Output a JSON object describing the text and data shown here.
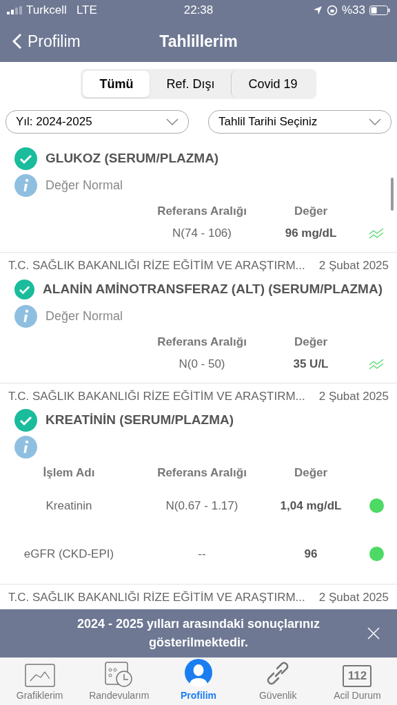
{
  "status_bar": {
    "carrier": "Turkcell",
    "network": "LTE",
    "time": "22:38",
    "battery": "%33"
  },
  "nav": {
    "back": "Profilim",
    "title": "Tahlillerim"
  },
  "tabs": [
    {
      "label": "Tümü",
      "selected": true
    },
    {
      "label": "Ref. Dışı",
      "selected": false
    },
    {
      "label": "Covid 19",
      "selected": false
    }
  ],
  "filters": [
    {
      "value": "Yıl: 2024-2025"
    },
    {
      "value": "Tahlil Tarihi Seçiniz"
    }
  ],
  "results": [
    {
      "title": "GLUKOZ (SERUM/PLAZMA)",
      "status": "Değer Normal",
      "columns": [
        "Referans Aralığı",
        "Değer"
      ],
      "rows": [
        {
          "range": "N(74 - 106)",
          "value": "96 mg/dL",
          "kind": "trend"
        }
      ]
    },
    {
      "source": "T.C. SAĞLIK BAKANLIĞI RİZE EĞİTİM VE ARAŞTIRM...",
      "date": "2 Şubat 2025",
      "title": "ALANİN AMİNOTRANSFERAZ (ALT) (SERUM/PLAZMA)",
      "status": "Değer Normal",
      "columns": [
        "Referans Aralığı",
        "Değer"
      ],
      "rows": [
        {
          "range": "N(0 - 50)",
          "value": "35 U/L",
          "kind": "trend"
        }
      ]
    },
    {
      "source": "T.C. SAĞLIK BAKANLIĞI RİZE EĞİTİM VE ARAŞTIRM...",
      "date": "2 Şubat 2025",
      "title": "KREATİNİN (SERUM/PLAZMA)",
      "name_column": "İşlem Adı",
      "columns": [
        "Referans Aralığı",
        "Değer"
      ],
      "rows": [
        {
          "name": "Kreatinin",
          "range": "N(0.67 - 1.17)",
          "value": "1,04 mg/dL",
          "kind": "dot",
          "color": "#4cd964"
        },
        {
          "name": "eGFR (CKD-EPI)",
          "range": "--",
          "value": "96",
          "kind": "dot",
          "color": "#4cd964"
        }
      ]
    },
    {
      "source": "T.C. SAĞLIK BAKANLIĞI RİZE EĞİTİM VE ARAŞTIRM...",
      "date": "2 Şubat 2025"
    }
  ],
  "banner": {
    "message": "2024 - 2025 yılları arasındaki sonuçlarınız gösterilmektedir."
  },
  "tab_bar": [
    {
      "label": "Grafiklerim",
      "kind": "chart",
      "selected": false
    },
    {
      "label": "Randevularım",
      "kind": "calendar",
      "selected": false
    },
    {
      "label": "Profilim",
      "kind": "person",
      "selected": true
    },
    {
      "label": "Güvenlik",
      "kind": "link",
      "selected": false
    },
    {
      "label": "Acil Durum",
      "kind": "emergency",
      "badge": "112",
      "selected": false
    }
  ]
}
